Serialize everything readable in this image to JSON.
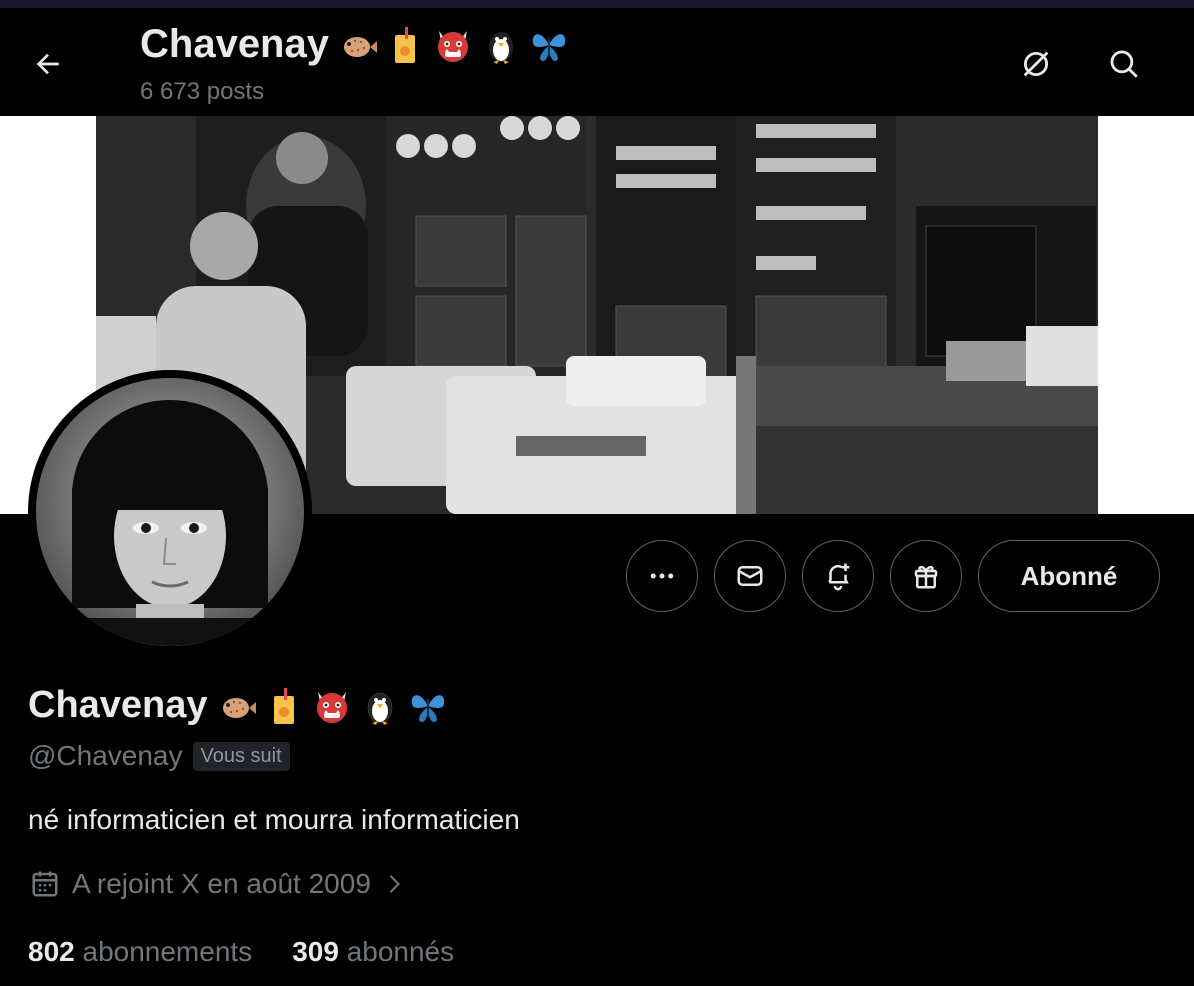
{
  "header": {
    "title": "Chavenay",
    "posts_count": "6 673 posts",
    "emojis": [
      "pufferfish-emoji",
      "juice-box-emoji",
      "ogre-emoji",
      "penguin-emoji",
      "butterfly-emoji"
    ]
  },
  "profile": {
    "display_name": "Chavenay",
    "handle": "@Chavenay",
    "follows_you_badge": "Vous suit",
    "bio": "né informaticien et mourra informaticien",
    "joined": "A rejoint X en août 2009"
  },
  "actions": {
    "follow_label": "Abonné",
    "icons": [
      "more-icon",
      "message-icon",
      "notification-bell-icon",
      "gift-icon"
    ]
  },
  "stats": {
    "following_count": "802",
    "following_label": "abonnements",
    "followers_count": "309",
    "followers_label": "abonnés"
  },
  "colors": {
    "background": "#000000",
    "primary_text": "#e7e9ea",
    "secondary_text": "#71767b",
    "border": "#536471",
    "badge_bg": "#202327"
  }
}
